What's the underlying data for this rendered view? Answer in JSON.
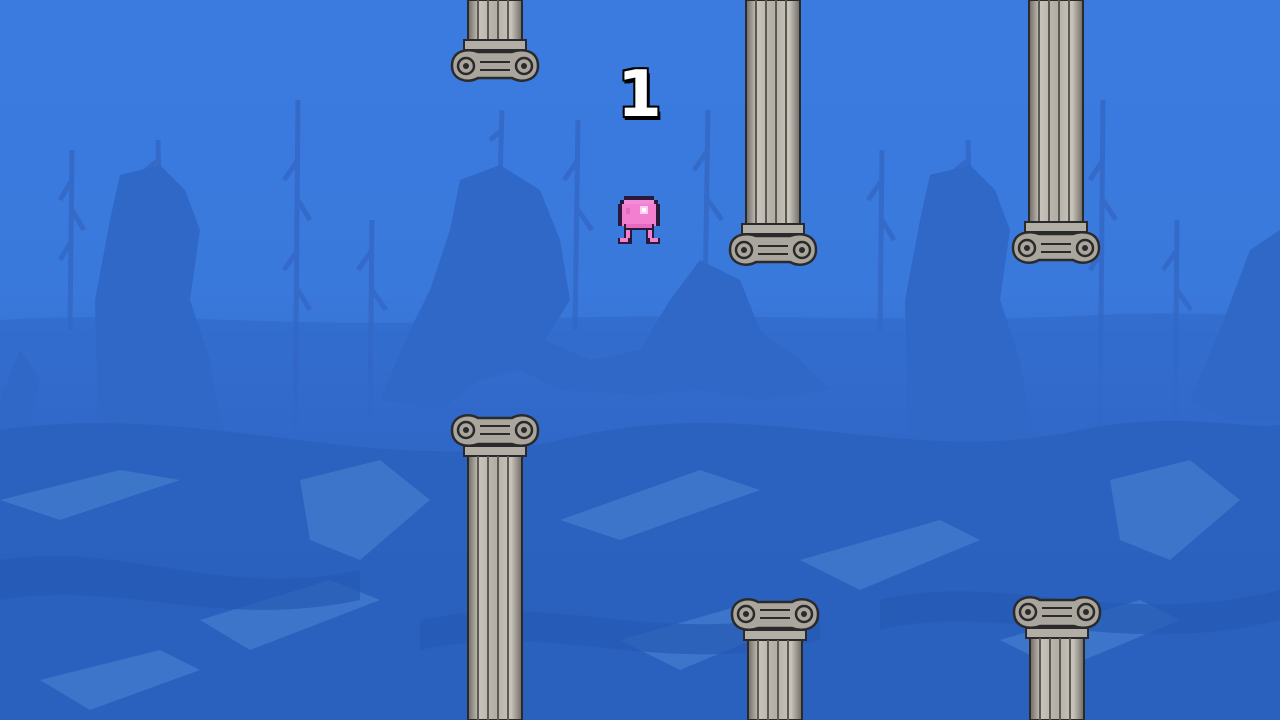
{
  "game": {
    "score": "1",
    "player": "pink-octopus",
    "obstacles": "ionic-columns",
    "background": "underwater-ruins"
  },
  "colors": {
    "water": "#3b7be0",
    "rock": "#2d64bf",
    "column": "#a9a49c",
    "player": "#f27fd0"
  }
}
